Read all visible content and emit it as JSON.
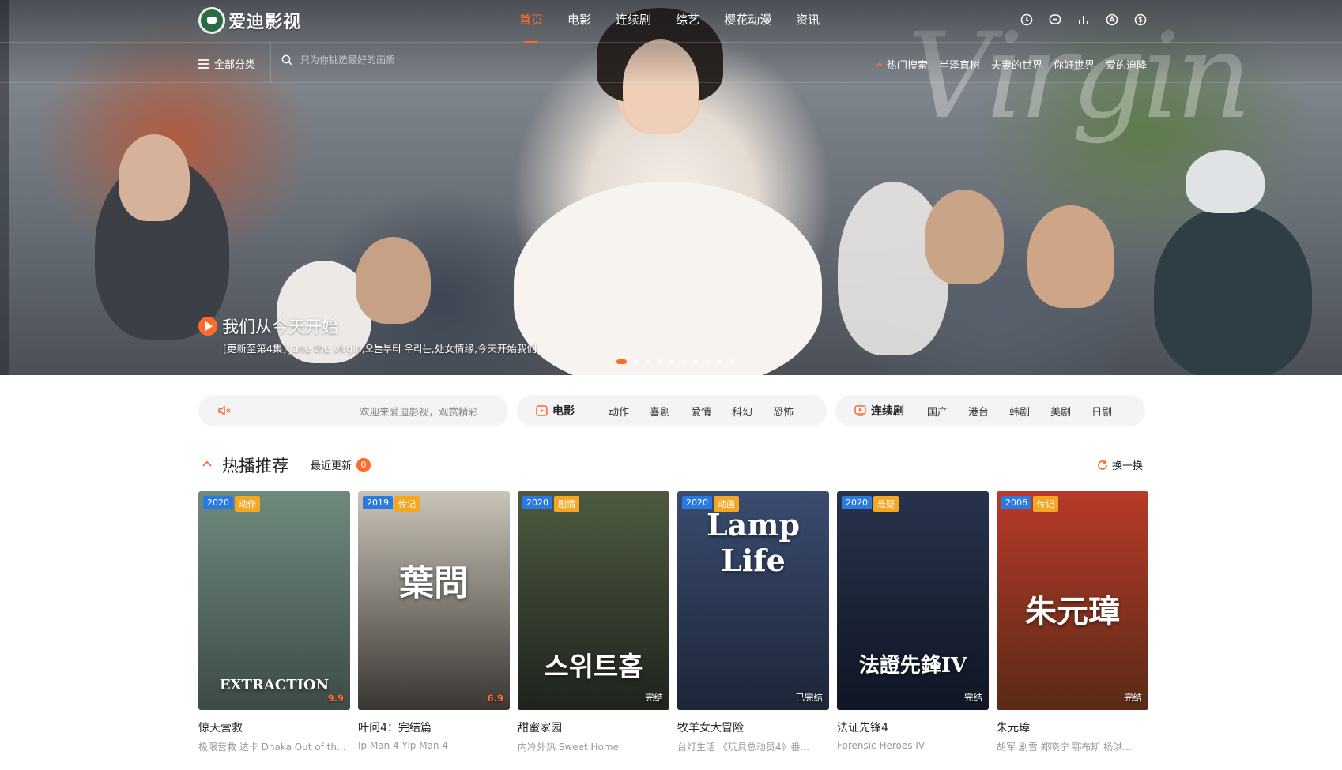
{
  "site": {
    "logo_text": "爱迪影视"
  },
  "nav": {
    "items": [
      {
        "label": "首页",
        "active": true
      },
      {
        "label": "电影"
      },
      {
        "label": "连续剧"
      },
      {
        "label": "综艺"
      },
      {
        "label": "樱花动漫"
      },
      {
        "label": "资讯"
      }
    ],
    "tool_icons": [
      "history-icon",
      "message-icon",
      "chart-icon",
      "app-icon",
      "dollar-icon"
    ]
  },
  "subbar": {
    "all_categories": "全部分类",
    "search_placeholder": "只为你挑选最好的画质",
    "hot_label": "热门搜索",
    "hot_terms": [
      "半泽直树",
      "夫妻的世界",
      "你好世界",
      "爱的迫降"
    ]
  },
  "hero": {
    "title": "我们从今天开始",
    "subtitle": "[更新至第4集] Jane the Virgin,오늘부터 우리는,处女情缘,今天开始我们",
    "slide_count": 10,
    "active_slide": 1
  },
  "notice": {
    "text": "欢迎来爱迪影视，观赏精彩"
  },
  "movie_bar": {
    "label": "电影",
    "links": [
      "动作",
      "喜剧",
      "爱情",
      "科幻",
      "恐怖"
    ]
  },
  "series_bar": {
    "label": "连续剧",
    "links": [
      "国产",
      "港台",
      "韩剧",
      "美剧",
      "日剧"
    ]
  },
  "section": {
    "title": "热播推荐",
    "recent_label": "最近更新",
    "recent_count": "0",
    "refresh_label": "换一换"
  },
  "cards": [
    {
      "year": "2020",
      "genre": "动作",
      "note": "9.9",
      "note_is_score": true,
      "title": "惊天营救",
      "actors": "极限营救 达卡 Dhaka Out of th...",
      "poster_text": "EXTRACTION",
      "colors": [
        "#6f8a7d",
        "#3d4b47"
      ]
    },
    {
      "year": "2019",
      "genre": "传记",
      "note": "6.9",
      "note_is_score": true,
      "title": "叶问4：完结篇",
      "actors": "Ip Man 4   Yip Man 4",
      "poster_text": "葉問",
      "colors": [
        "#c9c3b8",
        "#3a3632"
      ]
    },
    {
      "year": "2020",
      "genre": "剧情",
      "note": "完结",
      "note_is_score": false,
      "title": "甜蜜家园",
      "actors": "内冷外热 Sweet Home",
      "poster_text": "스위트홈",
      "colors": [
        "#4d5a40",
        "#1f231d"
      ]
    },
    {
      "year": "2020",
      "genre": "动画",
      "note": "已完结",
      "note_is_score": false,
      "title": "牧羊女大冒险",
      "actors": "台灯生活 《玩具总动员4》番...",
      "poster_text": "Lamp Life",
      "colors": [
        "#3a4c70",
        "#1d2538"
      ]
    },
    {
      "year": "2020",
      "genre": "悬疑",
      "note": "完结",
      "note_is_score": false,
      "title": "法证先锋4",
      "actors": "Forensic Heroes IV",
      "poster_text": "法證先鋒IV",
      "colors": [
        "#28334c",
        "#0f1524"
      ]
    },
    {
      "year": "2006",
      "genre": "传记",
      "note": "完结",
      "note_is_score": false,
      "title": "朱元璋",
      "actors": "胡军 剧雪 郑晓宁 鄂布斯 杨洪...",
      "poster_text": "朱元璋",
      "colors": [
        "#b83a2a",
        "#5a2a16"
      ]
    }
  ]
}
